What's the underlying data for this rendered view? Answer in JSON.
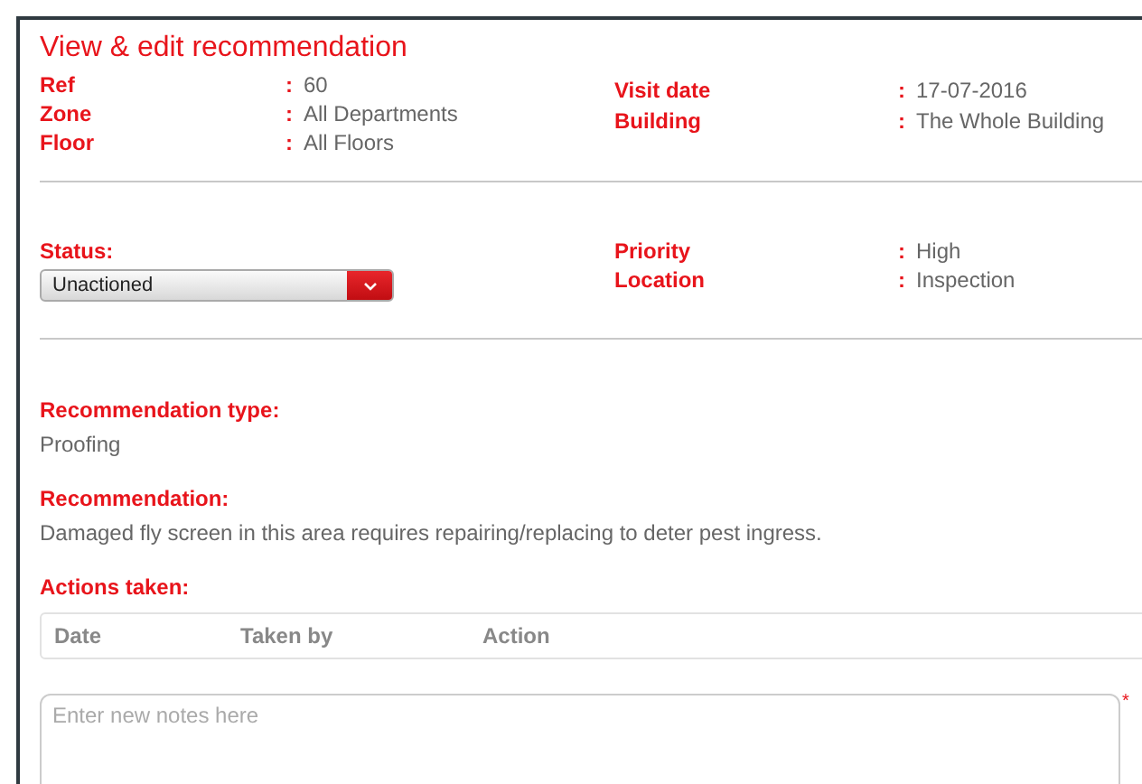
{
  "title": "View & edit recommendation",
  "details_left": [
    {
      "label": "Ref",
      "colon": ":",
      "value": "60"
    },
    {
      "label": "Zone",
      "colon": ":",
      "value": "All Departments"
    },
    {
      "label": "Floor",
      "colon": ":",
      "value": "All Floors"
    }
  ],
  "details_right": [
    {
      "label": "Visit date",
      "colon": ":",
      "value": "17-07-2016"
    },
    {
      "label": "Building",
      "colon": ":",
      "value": "The Whole Building"
    }
  ],
  "status": {
    "label": "Status:",
    "value": "Unactioned"
  },
  "status_right": [
    {
      "label": "Priority",
      "colon": ":",
      "value": "High"
    },
    {
      "label": "Location",
      "colon": ":",
      "value": "Inspection"
    }
  ],
  "recommendation_type": {
    "label": "Recommendation type:",
    "value": "Proofing"
  },
  "recommendation": {
    "label": "Recommendation:",
    "value": "Damaged fly screen in this area requires repairing/replacing to deter pest ingress."
  },
  "actions_taken": {
    "label": "Actions taken:",
    "columns": [
      "Date",
      "Taken by",
      "Action"
    ]
  },
  "notes": {
    "placeholder": "Enter new notes here",
    "required_mark": "*"
  }
}
